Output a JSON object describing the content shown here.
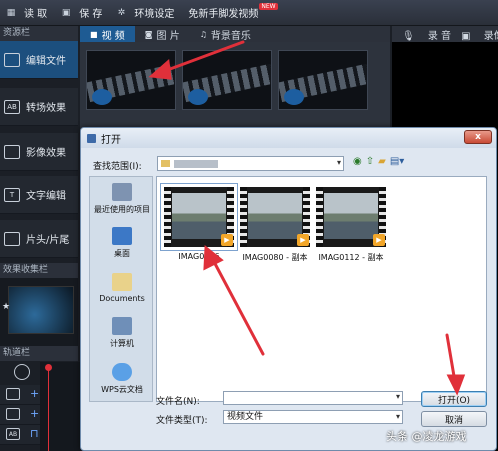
{
  "toolbar": {
    "read_label": "读 取",
    "save_label": "保 存",
    "settings_label": "环境设定",
    "free_video_label": "免新手脚发视频",
    "new_badge": "NEW"
  },
  "sidebar": {
    "title": "资源栏",
    "items": [
      {
        "icon": "edit-file-icon",
        "icon_text": "",
        "label": "编辑文件"
      },
      {
        "icon": "transition-icon",
        "icon_text": "AB",
        "label": "转场效果"
      },
      {
        "icon": "video-effect-icon",
        "icon_text": "",
        "label": "影像效果"
      },
      {
        "icon": "text-edit-icon",
        "icon_text": "T",
        "label": "文字编辑"
      },
      {
        "icon": "intro-outro-icon",
        "icon_text": "",
        "label": "片头/片尾"
      }
    ],
    "effects_title": "效果收集栏",
    "track_title": "轨道栏",
    "track_icons": [
      "",
      "",
      "AB",
      "T"
    ]
  },
  "media_tabs": [
    {
      "icon": "video-icon",
      "label": "视 频"
    },
    {
      "icon": "camera-icon",
      "label": "图 片"
    },
    {
      "icon": "music-icon",
      "label": "背景音乐"
    }
  ],
  "right_tabs": {
    "record_label": "录 音",
    "extra_label": "录像"
  },
  "dialog": {
    "title": "打开",
    "close_symbol": "x",
    "look_in_label": "查找范围(I):",
    "places": [
      {
        "icon": "recent-items-icon",
        "label": "最近使用的项目"
      },
      {
        "icon": "desktop-icon",
        "label": "桌面"
      },
      {
        "icon": "documents-icon",
        "label": "Documents"
      },
      {
        "icon": "computer-icon",
        "label": "计算机"
      },
      {
        "icon": "cloud-icon",
        "label": "WPS云文档"
      }
    ],
    "files": [
      {
        "name": "IMAG0096",
        "selected": true
      },
      {
        "name": "IMAG0080 - 副本",
        "selected": false
      },
      {
        "name": "IMAG0112 - 副本",
        "selected": false
      }
    ],
    "filename_label": "文件名(N):",
    "filename_value": "",
    "filetype_label": "文件类型(T):",
    "filetype_value": "视频文件",
    "open_button": "打开(O)",
    "cancel_button": "取消"
  },
  "watermark": "头条 @凌龙游戏",
  "colors": {
    "accent": "#1e5b93",
    "annotation_arrow": "#e0303a",
    "play_badge": "#f2a629"
  }
}
